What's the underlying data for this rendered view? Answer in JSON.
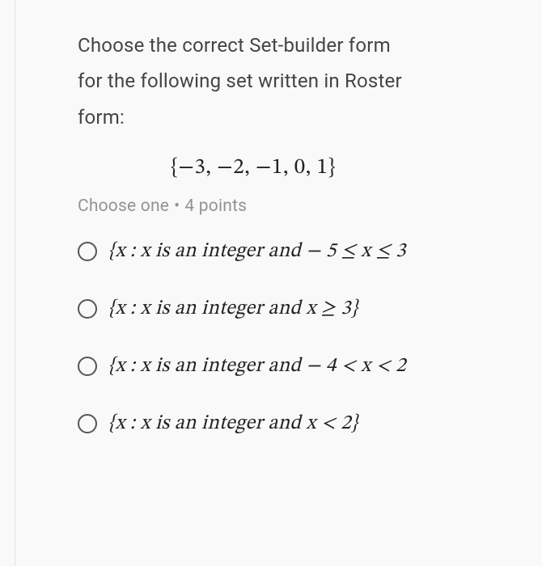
{
  "question": {
    "prompt_line1": "Choose the correct Set-builder form",
    "prompt_line2": "for the following set written in Roster",
    "prompt_line3": "form:",
    "roster_set": "{−3, −2, −1, 0, 1}",
    "instruction": "Choose one",
    "points_label": "4 points"
  },
  "options": [
    {
      "text": "{x : x is an integer and − 5 ≤ x ≤ 3"
    },
    {
      "text": "{x : x is an integer and x ≥ 3}"
    },
    {
      "text": "{x : x is an integer and − 4 < x < 2"
    },
    {
      "text": "{x : x is an integer and x < 2}"
    }
  ]
}
